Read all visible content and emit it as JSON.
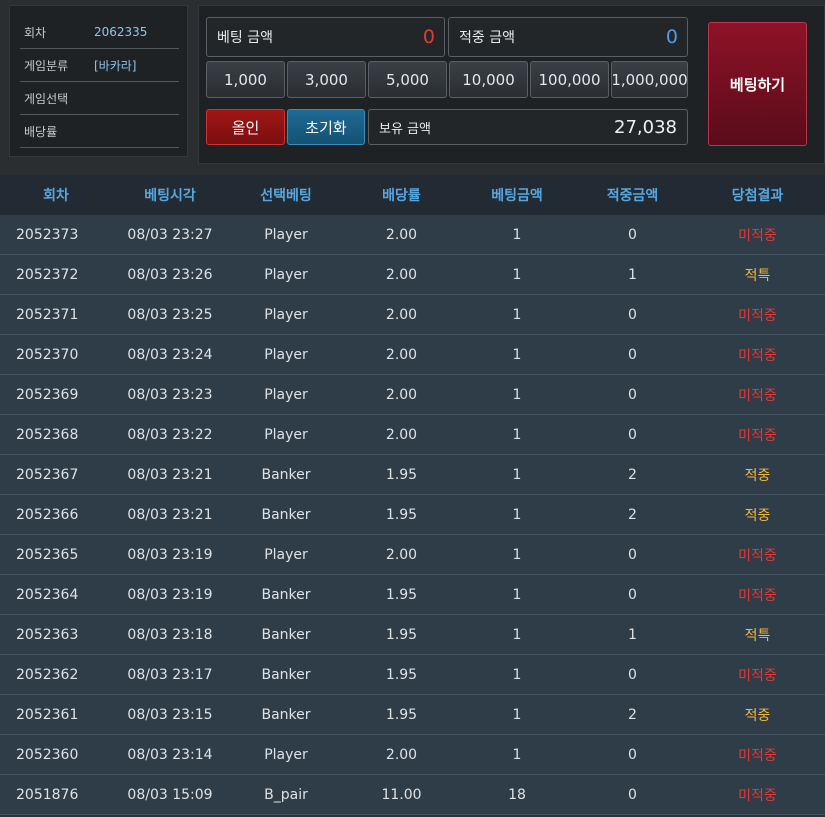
{
  "info": {
    "round_label": "회차",
    "round_value": "2062335",
    "category_label": "게임분류",
    "category_value": "[바카라]",
    "select_label": "게임선택",
    "select_value": "",
    "odds_label": "배당률",
    "odds_value": ""
  },
  "bet": {
    "bet_amount_label": "베팅 금액",
    "bet_amount_value": "0",
    "win_amount_label": "적중 금액",
    "win_amount_value": "0",
    "chips": [
      "1,000",
      "3,000",
      "5,000",
      "10,000",
      "100,000",
      "1,000,000"
    ],
    "allin_label": "올인",
    "reset_label": "초기화",
    "balance_label": "보유 금액",
    "balance_value": "27,038",
    "bet_button_label": "베팅하기",
    "colors": {
      "bet_value": "#e53935",
      "win_value": "#4f9de0"
    }
  },
  "history": {
    "headers": [
      "회차",
      "베팅시각",
      "선택베팅",
      "배당률",
      "베팅금액",
      "적중금액",
      "당첨결과"
    ],
    "rows": [
      {
        "round": "2052373",
        "time": "08/03 23:27",
        "pick": "Player",
        "odds": "2.00",
        "bet": "1",
        "win": "0",
        "result": "미적중"
      },
      {
        "round": "2052372",
        "time": "08/03 23:26",
        "pick": "Player",
        "odds": "2.00",
        "bet": "1",
        "win": "1",
        "result": "적특"
      },
      {
        "round": "2052371",
        "time": "08/03 23:25",
        "pick": "Player",
        "odds": "2.00",
        "bet": "1",
        "win": "0",
        "result": "미적중"
      },
      {
        "round": "2052370",
        "time": "08/03 23:24",
        "pick": "Player",
        "odds": "2.00",
        "bet": "1",
        "win": "0",
        "result": "미적중"
      },
      {
        "round": "2052369",
        "time": "08/03 23:23",
        "pick": "Player",
        "odds": "2.00",
        "bet": "1",
        "win": "0",
        "result": "미적중"
      },
      {
        "round": "2052368",
        "time": "08/03 23:22",
        "pick": "Player",
        "odds": "2.00",
        "bet": "1",
        "win": "0",
        "result": "미적중"
      },
      {
        "round": "2052367",
        "time": "08/03 23:21",
        "pick": "Banker",
        "odds": "1.95",
        "bet": "1",
        "win": "2",
        "result": "적중"
      },
      {
        "round": "2052366",
        "time": "08/03 23:21",
        "pick": "Banker",
        "odds": "1.95",
        "bet": "1",
        "win": "2",
        "result": "적중"
      },
      {
        "round": "2052365",
        "time": "08/03 23:19",
        "pick": "Player",
        "odds": "2.00",
        "bet": "1",
        "win": "0",
        "result": "미적중"
      },
      {
        "round": "2052364",
        "time": "08/03 23:19",
        "pick": "Banker",
        "odds": "1.95",
        "bet": "1",
        "win": "0",
        "result": "미적중"
      },
      {
        "round": "2052363",
        "time": "08/03 23:18",
        "pick": "Banker",
        "odds": "1.95",
        "bet": "1",
        "win": "1",
        "result": "적특"
      },
      {
        "round": "2052362",
        "time": "08/03 23:17",
        "pick": "Banker",
        "odds": "1.95",
        "bet": "1",
        "win": "0",
        "result": "미적중"
      },
      {
        "round": "2052361",
        "time": "08/03 23:15",
        "pick": "Banker",
        "odds": "1.95",
        "bet": "1",
        "win": "2",
        "result": "적중"
      },
      {
        "round": "2052360",
        "time": "08/03 23:14",
        "pick": "Player",
        "odds": "2.00",
        "bet": "1",
        "win": "0",
        "result": "미적중"
      },
      {
        "round": "2051876",
        "time": "08/03 15:09",
        "pick": "B_pair",
        "odds": "11.00",
        "bet": "18",
        "win": "0",
        "result": "미적중"
      }
    ]
  }
}
